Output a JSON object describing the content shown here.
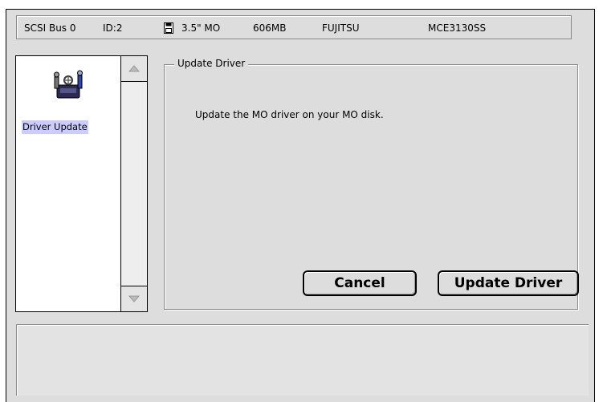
{
  "device": {
    "bus": "SCSI Bus 0",
    "id": "ID:2",
    "media_type": "3.5\" MO",
    "capacity": "606MB",
    "vendor": "FUJITSU",
    "model": "MCE3130SS",
    "icon": "disk-icon"
  },
  "sidebar": {
    "items": [
      {
        "label": "Driver Update",
        "icon": "driver-update-icon",
        "selected": true
      }
    ]
  },
  "panel": {
    "group_title": "Update Driver",
    "description": "Update the MO driver on your MO disk."
  },
  "buttons": {
    "cancel_label": "Cancel",
    "update_label": "Update Driver"
  },
  "colors": {
    "window_bg": "#dddddd",
    "selection": "#ccccff"
  }
}
